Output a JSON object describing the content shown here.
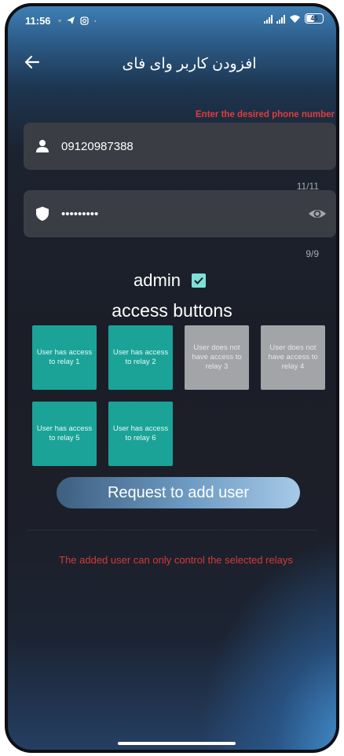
{
  "status_bar": {
    "time": "11:56",
    "battery": "45"
  },
  "app_bar": {
    "title": "افزودن کاربر وای فای"
  },
  "form": {
    "phone_hint": "Enter the desired phone number",
    "phone_value": "09120987388",
    "phone_counter": "11/11",
    "password_value": "•••••••••",
    "password_counter": "9/9"
  },
  "admin": {
    "label": "admin",
    "checked": true
  },
  "access": {
    "title": "access buttons",
    "relays": [
      {
        "label": "User has access to relay 1",
        "enabled": true
      },
      {
        "label": "User has access to relay 2",
        "enabled": true
      },
      {
        "label": "User does not have access to relay 3",
        "enabled": false
      },
      {
        "label": "User does not have access to relay 4",
        "enabled": false
      },
      {
        "label": "User has access to relay 5",
        "enabled": true
      },
      {
        "label": "User has access to relay 6",
        "enabled": true
      }
    ]
  },
  "actions": {
    "request_label": "Request to add user"
  },
  "footer": {
    "note": "The added user can only control the selected relays"
  },
  "colors": {
    "accent_teal": "#1ba398",
    "disabled_gray": "#a3a4a8",
    "warning_red": "#e23c3c"
  }
}
